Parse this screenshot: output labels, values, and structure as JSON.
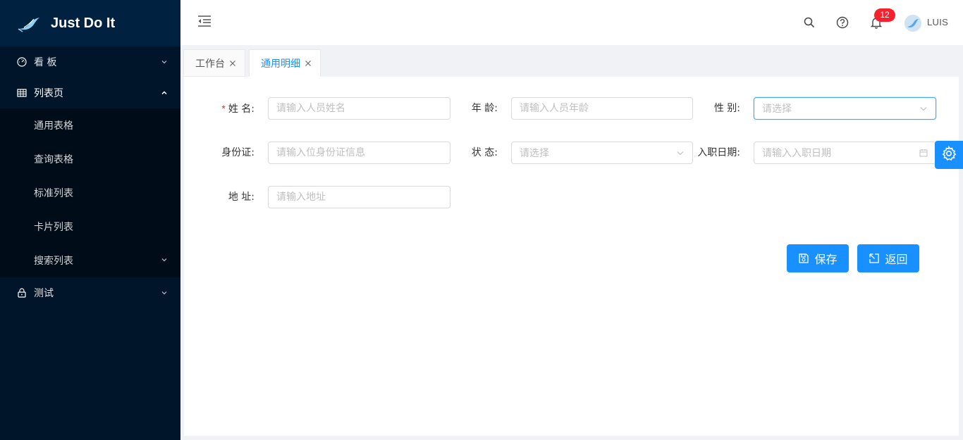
{
  "app": {
    "title": "Just Do It"
  },
  "sidebar": {
    "items": [
      {
        "label": "看 板",
        "icon": "dashboard-icon",
        "expanded": false
      },
      {
        "label": "列表页",
        "icon": "table-icon",
        "expanded": true,
        "children": [
          {
            "label": "通用表格"
          },
          {
            "label": "查询表格"
          },
          {
            "label": "标准列表"
          },
          {
            "label": "卡片列表"
          },
          {
            "label": "搜索列表",
            "has_children": true
          }
        ]
      },
      {
        "label": "测试",
        "icon": "lock-icon",
        "expanded": false
      }
    ]
  },
  "header": {
    "notification_count": "12",
    "username": "LUIS"
  },
  "tabs": [
    {
      "label": "工作台",
      "active": false
    },
    {
      "label": "通用明细",
      "active": true
    }
  ],
  "form": {
    "name": {
      "label": "姓 名:",
      "required_mark": "*",
      "placeholder": "请输入人员姓名"
    },
    "age": {
      "label": "年 龄:",
      "placeholder": "请输入人员年龄"
    },
    "gender": {
      "label": "性 别:",
      "placeholder": "请选择"
    },
    "id_card": {
      "label": "身份证:",
      "placeholder": "请输入位身份证信息"
    },
    "status": {
      "label": "状 态:",
      "placeholder": "请选择"
    },
    "hire_date": {
      "label": "入职日期:",
      "placeholder": "请输入入职日期"
    },
    "address": {
      "label": "地 址:",
      "placeholder": "请输入地址"
    }
  },
  "actions": {
    "save_label": "保存",
    "back_label": "返回"
  },
  "colors": {
    "primary": "#1890ff",
    "sidebar_bg": "#001529",
    "submenu_bg": "#000c17",
    "badge": "#f5222d"
  }
}
